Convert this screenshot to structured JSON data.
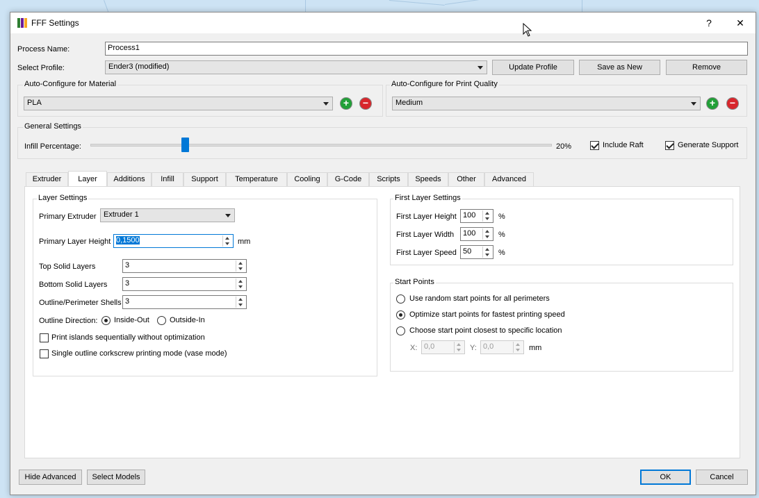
{
  "window": {
    "title": "FFF Settings",
    "help_glyph": "?",
    "close_glyph": "✕"
  },
  "top": {
    "process_name_label": "Process Name:",
    "process_name_value": "Process1",
    "select_profile_label": "Select Profile:",
    "select_profile_value": "Ender3 (modified)",
    "update_profile": "Update Profile",
    "save_as_new": "Save as New",
    "remove": "Remove"
  },
  "material": {
    "group_title": "Auto-Configure for Material",
    "value": "PLA",
    "add_glyph": "+",
    "remove_glyph": "−"
  },
  "quality": {
    "group_title": "Auto-Configure for Print Quality",
    "value": "Medium",
    "add_glyph": "+",
    "remove_glyph": "−"
  },
  "general": {
    "group_title": "General Settings",
    "infill_label": "Infill Percentage:",
    "infill_percent": 20,
    "infill_display": "20%",
    "include_raft_label": "Include Raft",
    "include_raft_checked": true,
    "generate_support_label": "Generate Support",
    "generate_support_checked": true
  },
  "tabs": [
    {
      "label": "Extruder"
    },
    {
      "label": "Layer",
      "active": true
    },
    {
      "label": "Additions"
    },
    {
      "label": "Infill"
    },
    {
      "label": "Support"
    },
    {
      "label": "Temperature"
    },
    {
      "label": "Cooling"
    },
    {
      "label": "G-Code"
    },
    {
      "label": "Scripts"
    },
    {
      "label": "Speeds"
    },
    {
      "label": "Other"
    },
    {
      "label": "Advanced"
    }
  ],
  "layer_settings": {
    "group_title": "Layer Settings",
    "primary_extruder_label": "Primary Extruder",
    "primary_extruder_value": "Extruder 1",
    "primary_layer_height_label": "Primary Layer Height",
    "primary_layer_height_value": "0,1500",
    "primary_layer_height_unit": "mm",
    "top_solid_layers_label": "Top Solid Layers",
    "top_solid_layers_value": "3",
    "bottom_solid_layers_label": "Bottom Solid Layers",
    "bottom_solid_layers_value": "3",
    "outline_shells_label": "Outline/Perimeter Shells",
    "outline_shells_value": "3",
    "outline_direction_label": "Outline Direction:",
    "inside_out_label": "Inside-Out",
    "outside_in_label": "Outside-In",
    "print_islands_label": "Print islands sequentially without optimization",
    "vase_mode_label": "Single outline corkscrew printing mode (vase mode)"
  },
  "first_layer": {
    "group_title": "First Layer Settings",
    "height_label": "First Layer Height",
    "height_value": "100",
    "width_label": "First Layer Width",
    "width_value": "100",
    "speed_label": "First Layer Speed",
    "speed_value": "50",
    "unit": "%"
  },
  "start_points": {
    "group_title": "Start Points",
    "option_random": "Use random start points for all perimeters",
    "option_optimize": "Optimize start points for fastest printing speed",
    "option_closest": "Choose start point closest to specific location",
    "x_label": "X:",
    "x_value": "0,0",
    "y_label": "Y:",
    "y_value": "0,0",
    "unit": "mm"
  },
  "bottom": {
    "hide_advanced": "Hide Advanced",
    "select_models": "Select Models",
    "ok": "OK",
    "cancel": "Cancel"
  },
  "colors": {
    "accent": "#0078d7",
    "plus_green": "#22a038",
    "minus_red": "#d8262c"
  }
}
